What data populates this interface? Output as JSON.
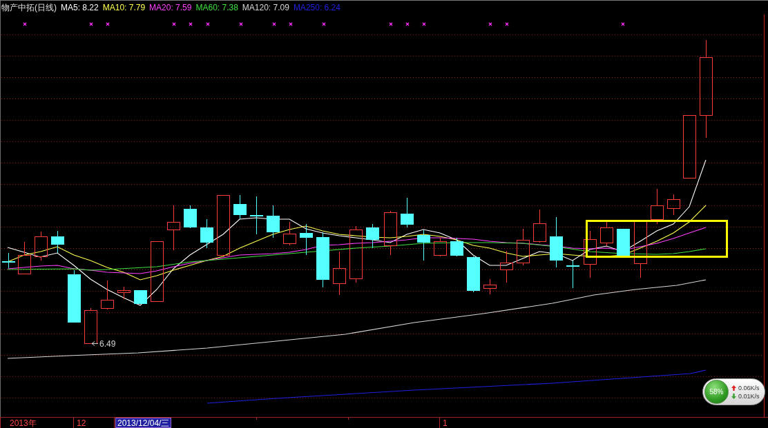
{
  "header": {
    "title": "物产中拓(日线)",
    "indicators": [
      {
        "label": "MA5: 8.22",
        "color": "#ffffff"
      },
      {
        "label": "MA10: 7.79",
        "color": "#ffff50"
      },
      {
        "label": "MA20: 7.59",
        "color": "#ff40ff"
      },
      {
        "label": "MA60: 7.38",
        "color": "#40e040"
      },
      {
        "label": "MA120: 7.09",
        "color": "#d8d8d8"
      },
      {
        "label": "MA250: 6.24",
        "color": "#2020e0"
      }
    ]
  },
  "chart": {
    "low_label": "6.49"
  },
  "time_axis": [
    {
      "label": "2013年",
      "selected": false
    },
    {
      "label": "12",
      "selected": false
    },
    {
      "label": "2013/12/04/三",
      "selected": true
    },
    {
      "label": "1",
      "selected": false
    }
  ],
  "net_monitor": {
    "percent": "58%",
    "upload": "0.06K/s",
    "download": "0.01K/s"
  }
}
